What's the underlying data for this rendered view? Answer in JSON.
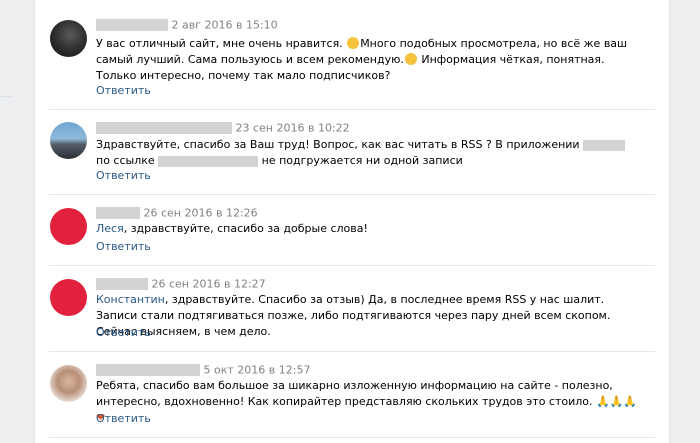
{
  "comments": [
    {
      "date": "2 авг 2016 в 15:10",
      "text_before": "У вас отличный сайт, мне очень нравится. ",
      "text_mid": "Много подобных просмотрела, но всё же ваш самый лучший. Сама пользуюсь и всем рекомендую.",
      "text_after": " Информация чёткая, понятная. Только интересно, почему так мало подписчиков?",
      "reply": "Ответить"
    },
    {
      "date": "23 сен 2016 в 10:22",
      "text_before": "Здравствуйте, спасибо за Ваш труд! Вопрос, как вас читать в RSS ? В приложении",
      "text_mid": " по ссылке",
      "text_after": " не подгружается ни одной записи",
      "reply": "Ответить"
    },
    {
      "date": "26 сен 2016 в 12:26",
      "mention": "Леся",
      "text_after": ", здравствуйте, спасибо за добрые слова!",
      "reply": "Ответить"
    },
    {
      "date": "26 сен 2016 в 12:27",
      "mention": "Константин",
      "text_after": ", здравствуйте. Спасибо за отзыв) Да, в последнее время RSS у нас шалит. Записи стали подтягиваться позже, либо подтягиваются через пару дней всем скопом. Сейчас выясняем, в чем дело.",
      "reply": "Ответить"
    },
    {
      "date": "5 окт 2016 в 12:57",
      "text_before": "Ребята, спасибо вам большое за шикарно изложенную информацию на сайте - полезно, интересно, вдохновенно! Как копирайтер представляю скольких трудов это стоило. ",
      "hands": "🙏🙏🙏",
      "heart": "❤",
      "reply": "Ответить"
    }
  ],
  "colors": {
    "link": "#2a5885",
    "date": "#828282",
    "avatar_red": "#e2213e"
  }
}
